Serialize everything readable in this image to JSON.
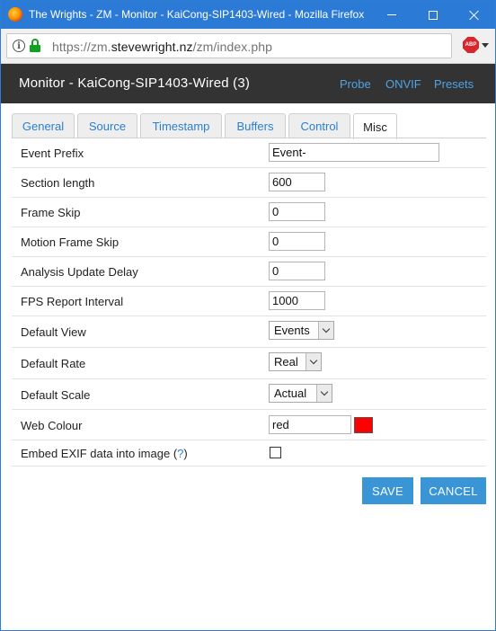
{
  "window": {
    "title": "The Wrights - ZM - Monitor - KaiCong-SIP1403-Wired - Mozilla Firefox"
  },
  "urlbar": {
    "prefix": "https://zm.",
    "domain": "stevewright.nz",
    "path": "/zm/index.php",
    "addon_label": "ABP"
  },
  "header": {
    "title": "Monitor - KaiCong-SIP1403-Wired (3)",
    "links": [
      "Probe",
      "ONVIF",
      "Presets"
    ]
  },
  "tabs": [
    {
      "label": "General",
      "active": false
    },
    {
      "label": "Source",
      "active": false
    },
    {
      "label": "Timestamp",
      "active": false
    },
    {
      "label": "Buffers",
      "active": false
    },
    {
      "label": "Control",
      "active": false
    },
    {
      "label": "Misc",
      "active": true
    }
  ],
  "fields": {
    "event_prefix": {
      "label": "Event Prefix",
      "value": "Event-"
    },
    "section_length": {
      "label": "Section length",
      "value": "600"
    },
    "frame_skip": {
      "label": "Frame Skip",
      "value": "0"
    },
    "motion_frame_skip": {
      "label": "Motion Frame Skip",
      "value": "0"
    },
    "analysis_update_delay": {
      "label": "Analysis Update Delay",
      "value": "0"
    },
    "fps_report_interval": {
      "label": "FPS Report Interval",
      "value": "1000"
    },
    "default_view": {
      "label": "Default View",
      "value": "Events"
    },
    "default_rate": {
      "label": "Default Rate",
      "value": "Real"
    },
    "default_scale": {
      "label": "Default Scale",
      "value": "Actual"
    },
    "web_colour": {
      "label": "Web Colour",
      "value": "red",
      "swatch_color": "#ff0000"
    },
    "embed_exif": {
      "label_before": "Embed EXIF data into image (",
      "help": "?",
      "label_after": ")",
      "checked": false
    }
  },
  "actions": {
    "save": "SAVE",
    "cancel": "CANCEL"
  },
  "colors": {
    "titlebar": "#2b7bd6",
    "header_bg": "#333333",
    "link": "#4fa3e6",
    "button": "#3a95d6"
  }
}
